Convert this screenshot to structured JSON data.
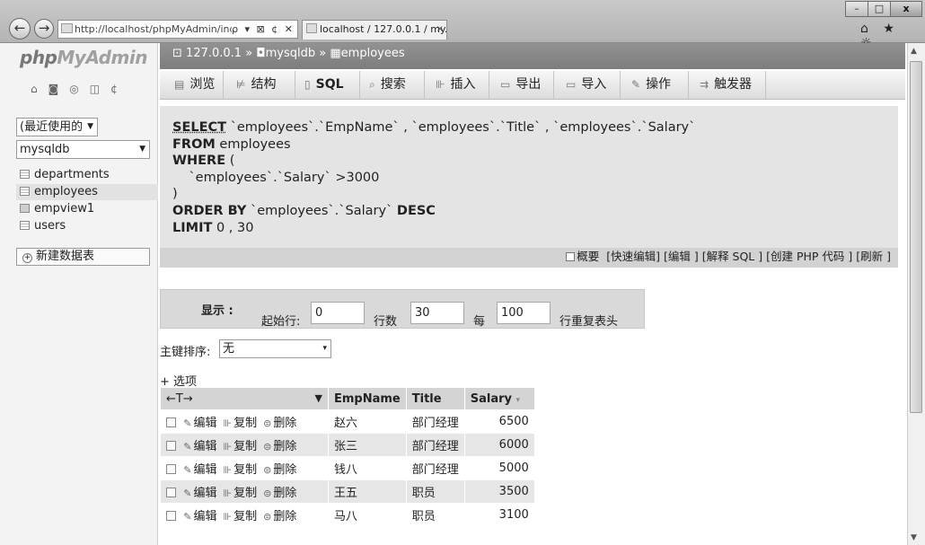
{
  "browser": {
    "address": "http://localhost/phpMyAdmin/inde",
    "address_tools": "ρ ▾ ⊠ ¢ ✕",
    "tab_title": "localhost / 127.0.0.1 / my...",
    "tab_close": "×",
    "window_buttons": [
      "–",
      "□",
      "x"
    ],
    "right_icons": "⌂ ★ ☼"
  },
  "sidebar": {
    "logo_php": "php",
    "logo_my": "MyAdmin",
    "quick_icons": "⌂◙◎◫¢",
    "recent_select": "(最近使用的",
    "db_select": "mysqldb",
    "tables": [
      {
        "name": "departments",
        "type": "table"
      },
      {
        "name": "employees",
        "type": "table",
        "selected": true
      },
      {
        "name": "empview1",
        "type": "view"
      },
      {
        "name": "users",
        "type": "table"
      }
    ],
    "new_table": "新建数据表"
  },
  "breadcrumb": {
    "server": "127.0.0.1",
    "sep1": "»",
    "database": "mysqldb",
    "sep2": "»",
    "table": "employees"
  },
  "tabs": [
    {
      "label": "浏览",
      "icon": "▤"
    },
    {
      "label": "结构",
      "icon": "⊭"
    },
    {
      "label": "SQL",
      "icon": "▯"
    },
    {
      "label": "搜索",
      "icon": "⌕"
    },
    {
      "label": "插入",
      "icon": "⊪"
    },
    {
      "label": "导出",
      "icon": "▭"
    },
    {
      "label": "导入",
      "icon": "▭"
    },
    {
      "label": "操作",
      "icon": "✎"
    },
    {
      "label": "触发器",
      "icon": "⇉"
    }
  ],
  "sql": {
    "l1_kw": "SELECT",
    "l1_rest": " `employees`.`EmpName` , `employees`.`Title` , `employees`.`Salary`",
    "l2_kw": "FROM",
    "l2_rest": " employees",
    "l3_kw": "WHERE",
    "l3_rest": " (",
    "l4": "    `employees`.`Salary` >3000",
    "l5": ")",
    "l6_kw1": "ORDER BY",
    "l6_mid": " `employees`.`Salary` ",
    "l6_kw2": "DESC",
    "l7_kw": "LIMIT",
    "l7_rest": " 0 , 30"
  },
  "sql_actions": {
    "profiling": "概要",
    "inline_edit": "[快速编辑]",
    "edit": "[编辑 ]",
    "explain": "[解释 SQL ]",
    "php_code": "[创建 PHP 代码 ]",
    "refresh": "[刷新 ]"
  },
  "display": {
    "label": "显示 :",
    "start_label": "起始行:",
    "start_value": "0",
    "rows_label": "行数",
    "rows_value": "30",
    "per_label": "每",
    "per_value": "100",
    "repeat_label": "行重复表头"
  },
  "sort": {
    "label": "主键排序:",
    "value": "无"
  },
  "options_label": "+ 选项",
  "table": {
    "header_arrows": "←T→",
    "header_dropdown": "▼",
    "columns": [
      "EmpName",
      "Title",
      "Salary"
    ],
    "sort_indicator": "▾",
    "actions": {
      "edit": "编辑",
      "copy": "复制",
      "delete": "删除"
    },
    "rows": [
      {
        "EmpName": "赵六",
        "Title": "部门经理",
        "Salary": "6500"
      },
      {
        "EmpName": "张三",
        "Title": "部门经理",
        "Salary": "6000"
      },
      {
        "EmpName": "钱八",
        "Title": "部门经理",
        "Salary": "5000"
      },
      {
        "EmpName": "王五",
        "Title": "职员",
        "Salary": "3500"
      },
      {
        "EmpName": "马八",
        "Title": "职员",
        "Salary": "3100"
      }
    ]
  }
}
